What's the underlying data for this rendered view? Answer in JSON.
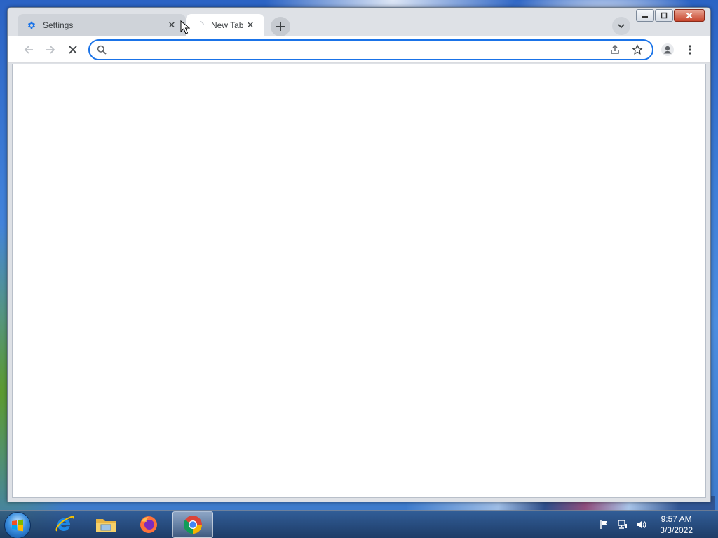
{
  "browser": {
    "tabs": [
      {
        "label": "Settings",
        "icon": "gear-icon",
        "active": false
      },
      {
        "label": "New Tab",
        "icon": "loading-icon",
        "active": true
      }
    ],
    "close_tab_glyph": "✕",
    "omnibox": {
      "value": "",
      "placeholder": ""
    },
    "accent": "#1a73e8"
  },
  "taskbar": {
    "apps": [
      "internet-explorer-icon",
      "file-explorer-icon",
      "firefox-icon",
      "chrome-icon"
    ],
    "active_app": "chrome-icon",
    "clock": {
      "time": "9:57 AM",
      "date": "3/3/2022"
    }
  }
}
